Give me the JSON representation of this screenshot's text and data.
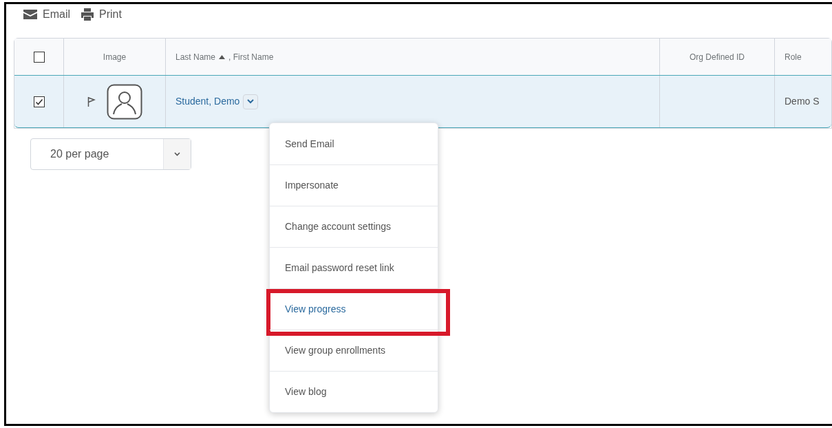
{
  "toolbar": [
    {
      "kind": "email",
      "label": "Email"
    },
    {
      "kind": "print",
      "label": "Print"
    }
  ],
  "table": {
    "columns": [
      {
        "kind": "checkbox",
        "checked": false
      },
      {
        "kind": "text",
        "label": "Image"
      },
      {
        "kind": "sort",
        "label": "Last Name",
        "label2": ", First Name"
      },
      {
        "kind": "text",
        "label": "Org Defined ID"
      },
      {
        "kind": "text",
        "label": "Role"
      }
    ],
    "rows": [
      {
        "selected": true,
        "checked": true,
        "name": "Student, Demo",
        "org_id": "",
        "role": "Demo S"
      }
    ]
  },
  "page_size": {
    "value": "20 per page"
  },
  "context_menu": {
    "items": [
      {
        "label": "Send Email",
        "selected": false
      },
      {
        "label": "Impersonate",
        "selected": false
      },
      {
        "label": "Change account settings",
        "selected": false
      },
      {
        "label": "Email password reset link",
        "selected": false
      },
      {
        "label": "View progress",
        "selected": true
      },
      {
        "label": "View group enrollments",
        "selected": false
      },
      {
        "label": "View blog",
        "selected": false
      }
    ]
  }
}
